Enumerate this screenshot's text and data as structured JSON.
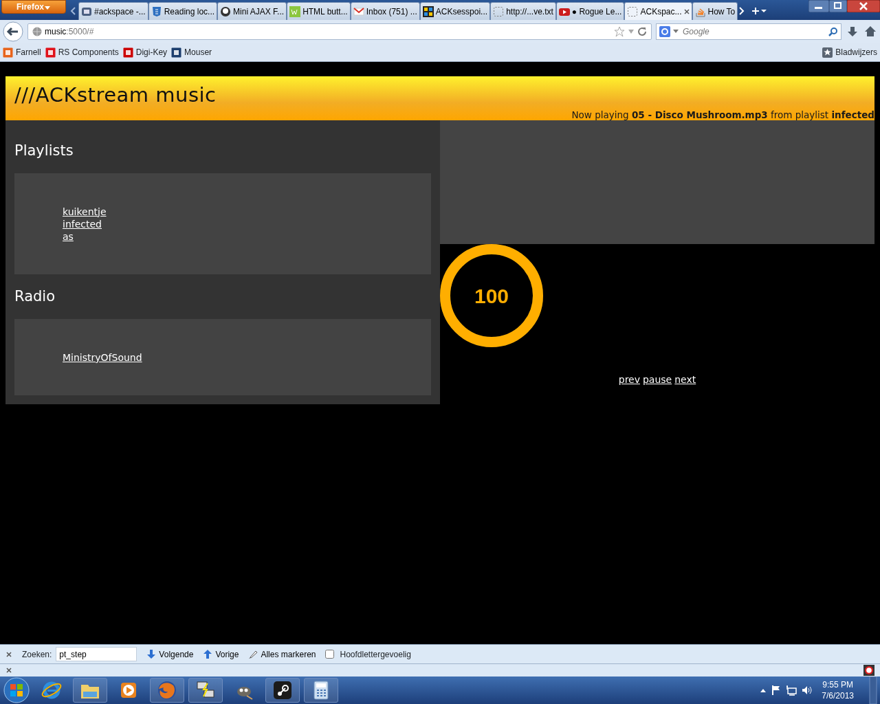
{
  "browser": {
    "menu_button": "Firefox",
    "tabs": [
      {
        "label": "#ackspace -...",
        "selected": false,
        "kind": "irc"
      },
      {
        "label": "Reading loc...",
        "selected": false,
        "kind": "html5"
      },
      {
        "label": "Mini AJAX F...",
        "selected": false,
        "kind": "bubble"
      },
      {
        "label": "HTML butt...",
        "selected": false,
        "kind": "w3"
      },
      {
        "label": "Inbox (751) ...",
        "selected": false,
        "kind": "mail"
      },
      {
        "label": "ACKsesspoi...",
        "selected": false,
        "kind": "grid"
      },
      {
        "label": "http://...ve.txt",
        "selected": false,
        "kind": "blank"
      },
      {
        "label": "● Rogue Le...",
        "selected": false,
        "kind": "video"
      },
      {
        "label": "ACKspac...",
        "selected": true,
        "kind": "blank"
      },
      {
        "label": "How To",
        "selected": false,
        "kind": "stack"
      }
    ],
    "address": {
      "host": "music",
      "rest": ":5000/#"
    },
    "search": {
      "placeholder": "Google"
    },
    "bookmarks": [
      {
        "label": "Farnell",
        "color": "#e8641b"
      },
      {
        "label": "RS Components",
        "color": "#e0121b"
      },
      {
        "label": "Digi-Key",
        "color": "#cc0000"
      },
      {
        "label": "Mouser",
        "color": "#1d3f6e"
      }
    ],
    "bookmarks_menu": "Bladwijzers"
  },
  "page": {
    "title": "///ACKstream music",
    "now_playing": "Now playing **05 - Disco Mushroom.mp3** from playlist **infected**",
    "sections": [
      {
        "heading": "Playlists",
        "links": [
          "kuikentje",
          "infected",
          "as"
        ]
      },
      {
        "heading": "Radio",
        "links": [
          "MinistryOfSound"
        ]
      }
    ],
    "volume": "100",
    "level": 1,
    "controls": [
      "prev",
      "pause",
      "next"
    ]
  },
  "find_bar": {
    "label": "Zoeken:",
    "value": "pt_step",
    "buttons": [
      {
        "label": "Volgende",
        "kind": "down"
      },
      {
        "label": "Vorige",
        "kind": "up"
      },
      {
        "label": "Alles markeren",
        "kind": "highlight"
      }
    ],
    "checkbox": {
      "label": "Hoofdlettergevoelig",
      "checked": false
    }
  },
  "taskbar": {
    "apps": [
      {
        "kind": "ie"
      },
      {
        "kind": "folder"
      },
      {
        "kind": "media"
      },
      {
        "kind": "firefox"
      },
      {
        "kind": "putty"
      },
      {
        "kind": "gimp"
      },
      {
        "kind": "steam"
      },
      {
        "kind": "calculator"
      }
    ],
    "time": "9:55 PM",
    "date": "7/6/2013"
  }
}
